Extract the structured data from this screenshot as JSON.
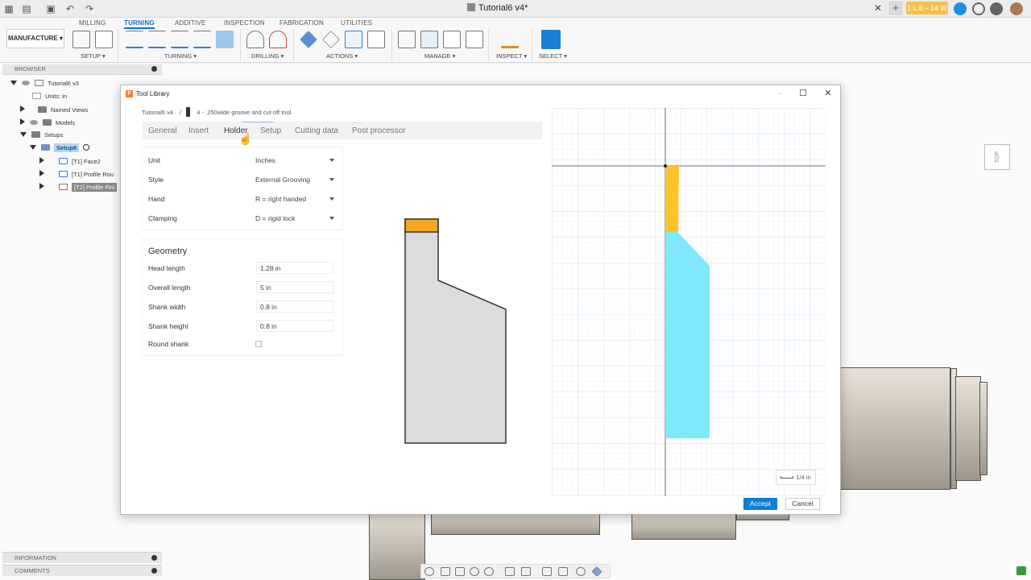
{
  "window": {
    "document_title": "Tutorial6 v4*",
    "trial_badge": "1 L E - 14 W"
  },
  "ribbon": {
    "tabs": [
      "MILLING",
      "TURNING",
      "ADDITIVE",
      "INSPECTION",
      "FABRICATION",
      "UTILITIES"
    ],
    "active_tab": "TURNING",
    "workspace": "MANUFACTURE ▾",
    "groups": {
      "setup": "SETUP ▾",
      "turning": "TURNING ▾",
      "drilling": "DRILLING ▾",
      "actions": "ACTIONS ▾",
      "manage": "MANAGE ▾",
      "inspect": "INSPECT ▾",
      "select": "SELECT ▾"
    }
  },
  "browser": {
    "header": "BROWSER",
    "items": {
      "root": "Tutorial6 v3",
      "units": "Units: in",
      "named_views": "Named Views",
      "models": "Models",
      "setups": "Setups",
      "setup8": "Setup8",
      "op1": "[T1] Face2",
      "op2": "[T1] Profile Rou",
      "op3": "[T2] Profile Fini"
    }
  },
  "bottom_panels": {
    "information": "INFORMATION",
    "comments": "COMMENTS"
  },
  "viewcube": {
    "label": "TOP"
  },
  "dialog": {
    "title": "Tool Library",
    "breadcrumb": {
      "library": "Tutorial6 v4",
      "separator": "/",
      "tool": "4 - .250wide groove and cut off tool"
    },
    "tabs": {
      "general": "General",
      "insert": "Insert",
      "holder": "Holder",
      "setup": "Setup",
      "cutting_data": "Cutting data",
      "post_processor": "Post processor"
    },
    "active_tab": "Holder",
    "properties": {
      "unit_label": "Unit",
      "unit_value": "Inches",
      "style_label": "Style",
      "style_value": "External Grooving",
      "hand_label": "Hand",
      "hand_value": "R = right handed",
      "clamping_label": "Clamping",
      "clamping_value": "D = rigid lock"
    },
    "geometry": {
      "title": "Geometry",
      "head_length_label": "Head length",
      "head_length": "1.28 in",
      "overall_length_label": "Overall length",
      "overall_length": "5 in",
      "shank_width_label": "Shank width",
      "shank_width": "0.8 in",
      "shank_height_label": "Shank height",
      "shank_height": "0.8 in",
      "round_shank_label": "Round shank",
      "round_shank": false
    },
    "scale_label": "1/4 in",
    "accept": "Accept",
    "cancel": "Cancel"
  },
  "colors": {
    "accent": "#0b7ed6",
    "insert": "#f5a623",
    "insert_preview": "#ffc32a",
    "holder_preview": "#7fe9fb",
    "holder_side": "#dcdcdc"
  }
}
